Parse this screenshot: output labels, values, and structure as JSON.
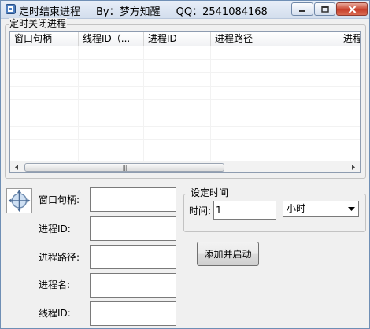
{
  "window": {
    "title": "定时结束进程",
    "author": "By：梦方知醒",
    "contact": "QQ：2541084168"
  },
  "process_group": {
    "label": "定时关闭进程",
    "columns": [
      "窗口句柄",
      "线程ID（...",
      "进程ID",
      "进程路径",
      "进程"
    ]
  },
  "details": {
    "handle_label": "窗口句柄:",
    "pid_label": "进程ID:",
    "path_label": "进程路径:",
    "name_label": "进程名:",
    "tid_label": "线程ID:"
  },
  "timer_group": {
    "label": "设定时间",
    "time_label": "时间:",
    "time_value": "1",
    "unit_selected": "小时"
  },
  "actions": {
    "add_start_label": "添加并启动"
  }
}
